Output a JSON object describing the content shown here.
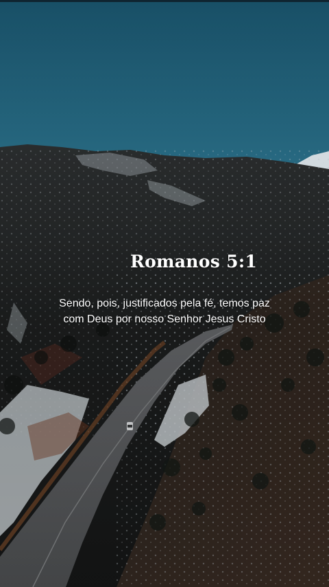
{
  "post": {
    "reference": "Romanos 5:1",
    "verse_lines": [
      "Sendo, pois, justificados pela fé, temos paz",
      "com Deus por nosso Senhor Jesus Cristo"
    ]
  },
  "background": {
    "description_icon": "mountain-road-aerial-photo",
    "sky_color": "#1e5f76",
    "forest_color": "#1b1d1c",
    "road_color": "#585a5c"
  }
}
